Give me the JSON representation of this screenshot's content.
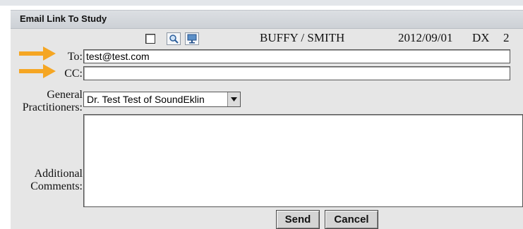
{
  "dialog": {
    "title": "Email Link To Study"
  },
  "header": {
    "patient_name": "BUFFY / SMITH",
    "study_date": "2012/09/01",
    "modality": "DX",
    "count": "2",
    "icons": [
      "checkbox",
      "magnifier-icon",
      "monitor-icon"
    ]
  },
  "form": {
    "to_label": "To:",
    "to_value": "test@test.com",
    "cc_label": "CC:",
    "cc_value": "",
    "gp_label_line1": "General",
    "gp_label_line2": "Practitioners:",
    "gp_selected": "Dr. Test Test of SoundEklin",
    "comments_label_line1": "Additional",
    "comments_label_line2": "Comments:",
    "comments_value": ""
  },
  "buttons": {
    "send": "Send",
    "cancel": "Cancel"
  },
  "annotations": {
    "arrow_color": "#f5a623",
    "arrow_count": 2
  }
}
